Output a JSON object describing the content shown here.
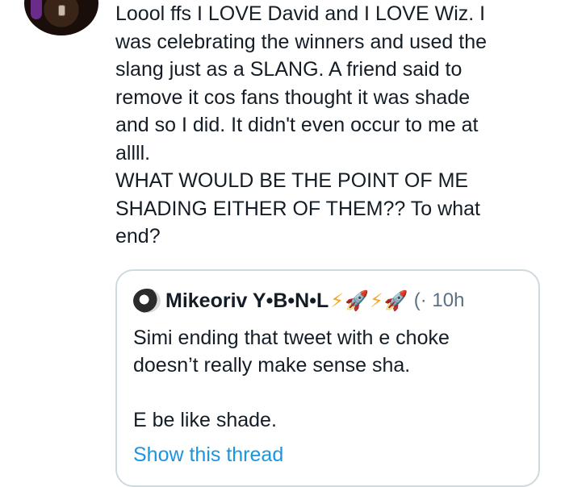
{
  "tweet": {
    "lines": [
      "Loool ffs I LOVE David and I LOVE Wiz. I",
      "was celebrating the winners and used the",
      "slang just as a SLANG. A friend said to",
      "remove it cos fans thought it was shade",
      "and so I did. It didn't even occur to me at",
      "allll.",
      "WHAT WOULD BE THE POINT OF ME",
      "SHADING EITHER OF THEM?? To what",
      "end?"
    ]
  },
  "quoted_tweet": {
    "author_name": "Mikeoriv Y•B•N•L",
    "author_emoji": {
      "bolt": "⚡",
      "rocket": "🚀"
    },
    "meta": "(· 10h",
    "body_lines": [
      "Simi ending that tweet with e choke",
      "doesn’t really make sense sha."
    ],
    "body_extra": "E be like shade.",
    "show_thread_label": "Show this thread"
  },
  "colors": {
    "text": "#141d26",
    "link": "#1b95e0",
    "muted": "#5b7083",
    "card_border": "#cfd9de"
  }
}
